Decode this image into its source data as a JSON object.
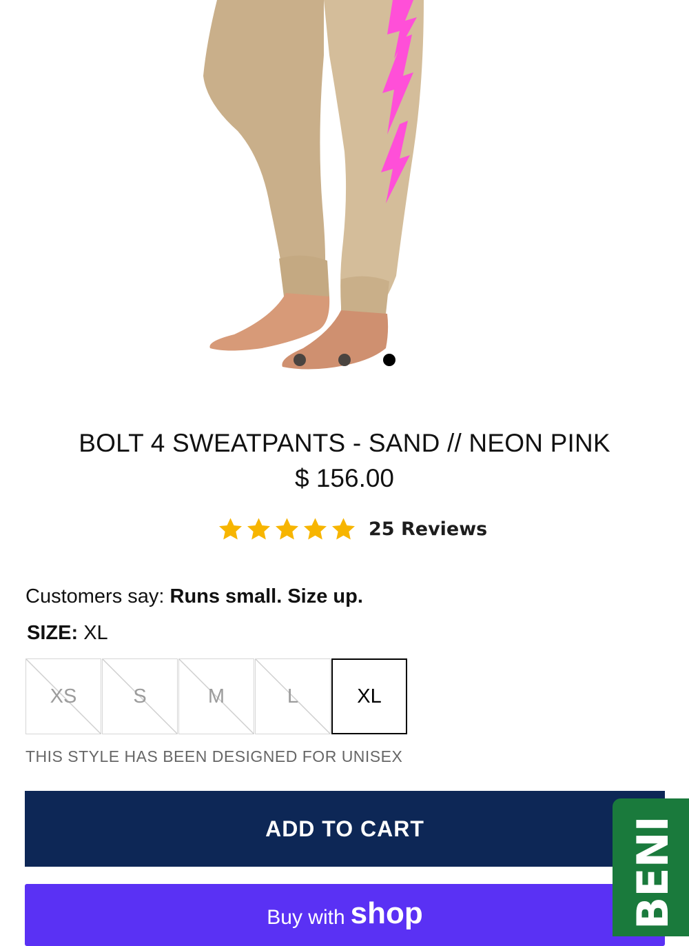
{
  "product": {
    "title": "BOLT 4 SWEATPANTS - SAND // NEON PINK",
    "price": "$ 156.00",
    "rating": 5,
    "reviews_label": "25 Reviews"
  },
  "gallery": {
    "slide_count": 3,
    "active_index": 2
  },
  "fit_note": {
    "prefix": "Customers say: ",
    "text": "Runs small. Size up."
  },
  "size": {
    "label": "SIZE:",
    "selected": "XL",
    "options": [
      {
        "label": "XS",
        "available": false
      },
      {
        "label": "S",
        "available": false
      },
      {
        "label": "M",
        "available": false
      },
      {
        "label": "L",
        "available": false
      },
      {
        "label": "XL",
        "available": true
      }
    ]
  },
  "unisex_note": "THIS STYLE HAS BEEN DESIGNED FOR UNISEX",
  "buttons": {
    "add_to_cart": "ADD TO CART",
    "shop_pay_prefix": "Buy with",
    "shop_pay_brand": "shop"
  },
  "side_tab": {
    "label": "BENI"
  },
  "colors": {
    "pant": "#cdb592",
    "bolt": "#ff4fd8",
    "star": "#f7b500",
    "cart": "#0d2756",
    "shop_pay": "#5a31f4",
    "side_tab": "#1a7a3c"
  }
}
